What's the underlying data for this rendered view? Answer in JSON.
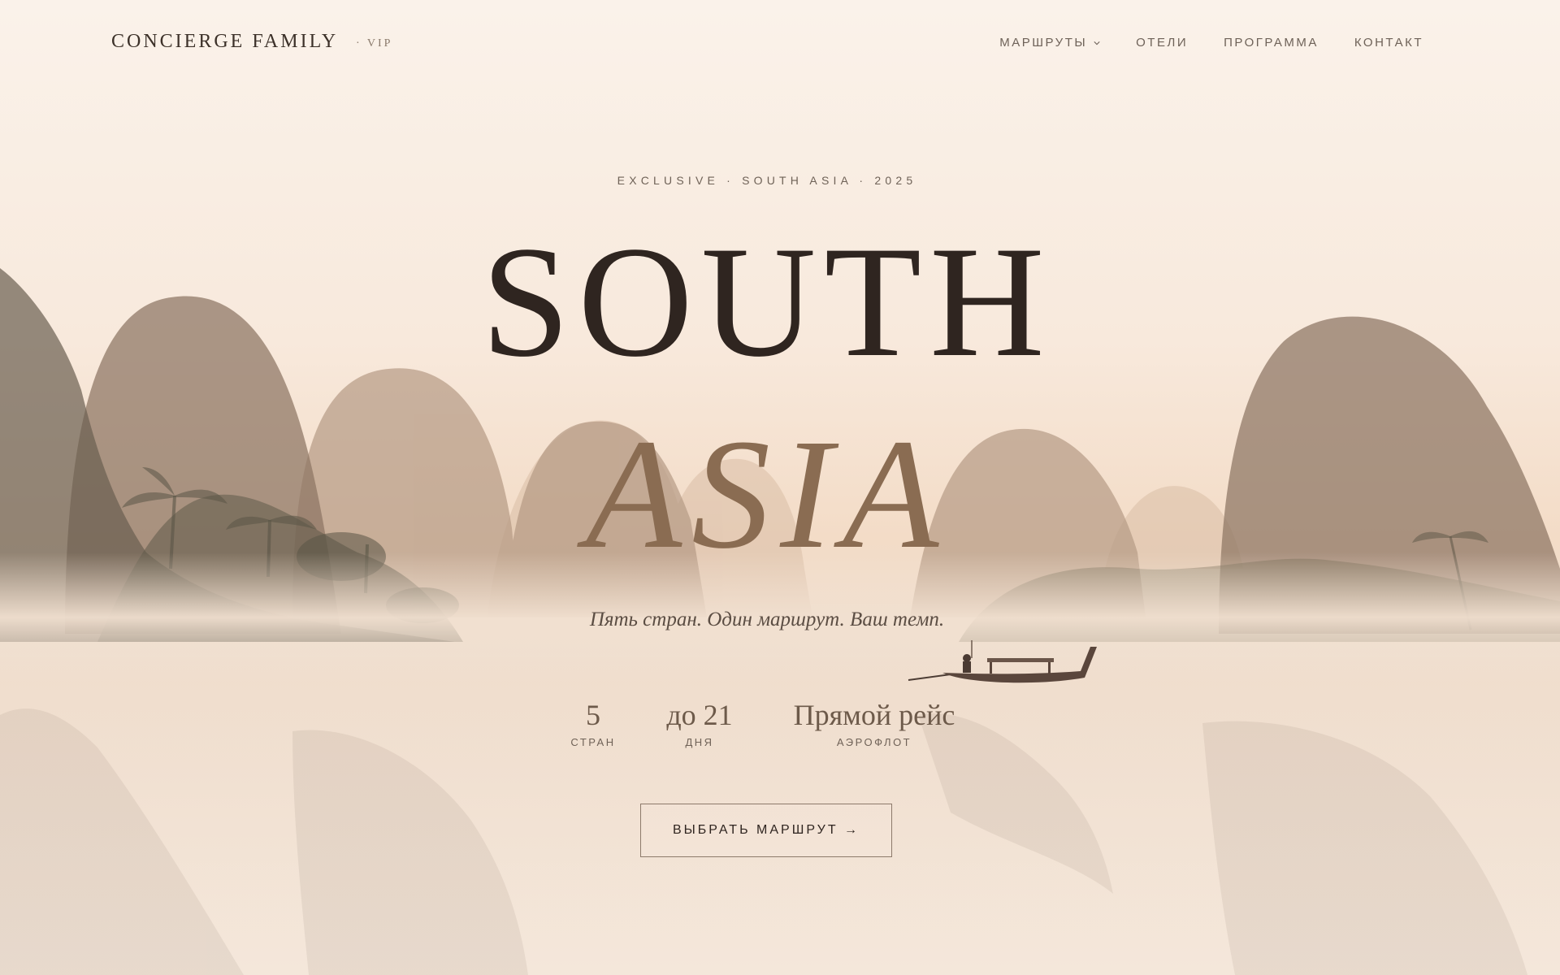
{
  "header": {
    "logo": "CONCIERGE FAMILY",
    "logo_sub": "· VIP",
    "nav": [
      {
        "label": "МАРШРУТЫ"
      },
      {
        "label": "ОТЕЛИ"
      },
      {
        "label": "ПРОГРАММА"
      },
      {
        "label": "КОНТАКТ"
      }
    ]
  },
  "hero": {
    "eyebrow": "EXCLUSIVE · SOUTH ASIA · 2025",
    "title_line1": "SOUTH",
    "title_line2": "ASIA",
    "tagline": "Пять стран. Один маршрут. Ваш темп.",
    "stats": [
      {
        "value": "5",
        "label": "СТРАН"
      },
      {
        "value": "до 21",
        "label": "ДНЯ"
      },
      {
        "value": "Прямой рейс",
        "label": "АЭРОФЛОТ"
      }
    ],
    "cta": "ВЫБРАТЬ МАРШРУТ →"
  },
  "colors": {
    "sky_top": "#f8eee4",
    "sky_mid": "#f4dcc6",
    "ink": "#2f2520",
    "accent": "#8a6c52"
  },
  "icons": {
    "nav_dropdown": "chevron-down-icon",
    "boat": "longtail-boat-icon"
  }
}
